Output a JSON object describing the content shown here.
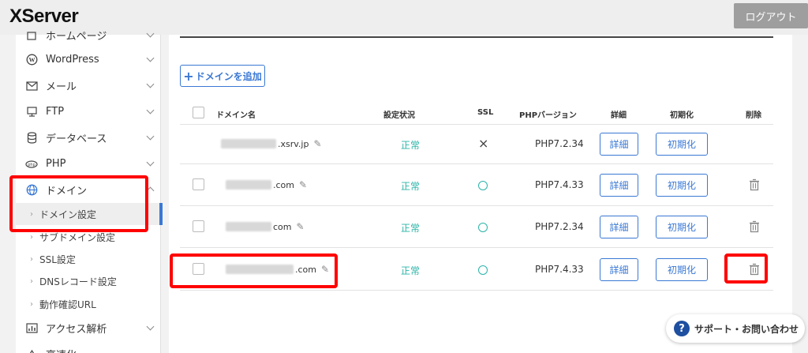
{
  "app": {
    "logo": "XServer",
    "logout_label": "ログアウト"
  },
  "sidebar": {
    "items": [
      {
        "label": "ホームページ",
        "icon": "home-icon"
      },
      {
        "label": "WordPress",
        "icon": "wordpress-icon"
      },
      {
        "label": "メール",
        "icon": "mail-icon"
      },
      {
        "label": "FTP",
        "icon": "ftp-icon"
      },
      {
        "label": "データベース",
        "icon": "database-icon"
      },
      {
        "label": "PHP",
        "icon": "php-icon"
      },
      {
        "label": "ドメイン",
        "icon": "globe-icon"
      },
      {
        "label": "アクセス解析",
        "icon": "chart-icon"
      },
      {
        "label": "高速化",
        "icon": "speed-icon"
      }
    ],
    "domain_sub": [
      {
        "label": "ドメイン設定"
      },
      {
        "label": "サブドメイン設定"
      },
      {
        "label": "SSL設定"
      },
      {
        "label": "DNSレコード設定"
      },
      {
        "label": "動作確認URL"
      }
    ]
  },
  "main": {
    "add_domain_label": "ドメインを追加",
    "columns": {
      "domain": "ドメイン名",
      "status": "設定状況",
      "ssl": "SSL",
      "php": "PHPバージョン",
      "details": "詳細",
      "init": "初期化",
      "delete": "削除"
    },
    "rows": [
      {
        "domain_suffix": ".xsrv.jp",
        "status": "正常",
        "ssl": "×",
        "php": "PHP7.2.34",
        "details": "詳細",
        "init": "初期化"
      },
      {
        "domain_suffix": ".com",
        "status": "正常",
        "ssl": "○",
        "php": "PHP7.4.33",
        "details": "詳細",
        "init": "初期化"
      },
      {
        "domain_suffix": "com",
        "status": "正常",
        "ssl": "○",
        "php": "PHP7.2.34",
        "details": "詳細",
        "init": "初期化"
      },
      {
        "domain_suffix": ".com",
        "status": "正常",
        "ssl": "○",
        "php": "PHP7.4.33",
        "details": "詳細",
        "init": "初期化"
      }
    ]
  },
  "support": {
    "label": "サポート・お問い合わせ"
  },
  "colors": {
    "accent": "#3a78d4",
    "ok": "#2bb5a8",
    "highlight": "#ff0000"
  }
}
